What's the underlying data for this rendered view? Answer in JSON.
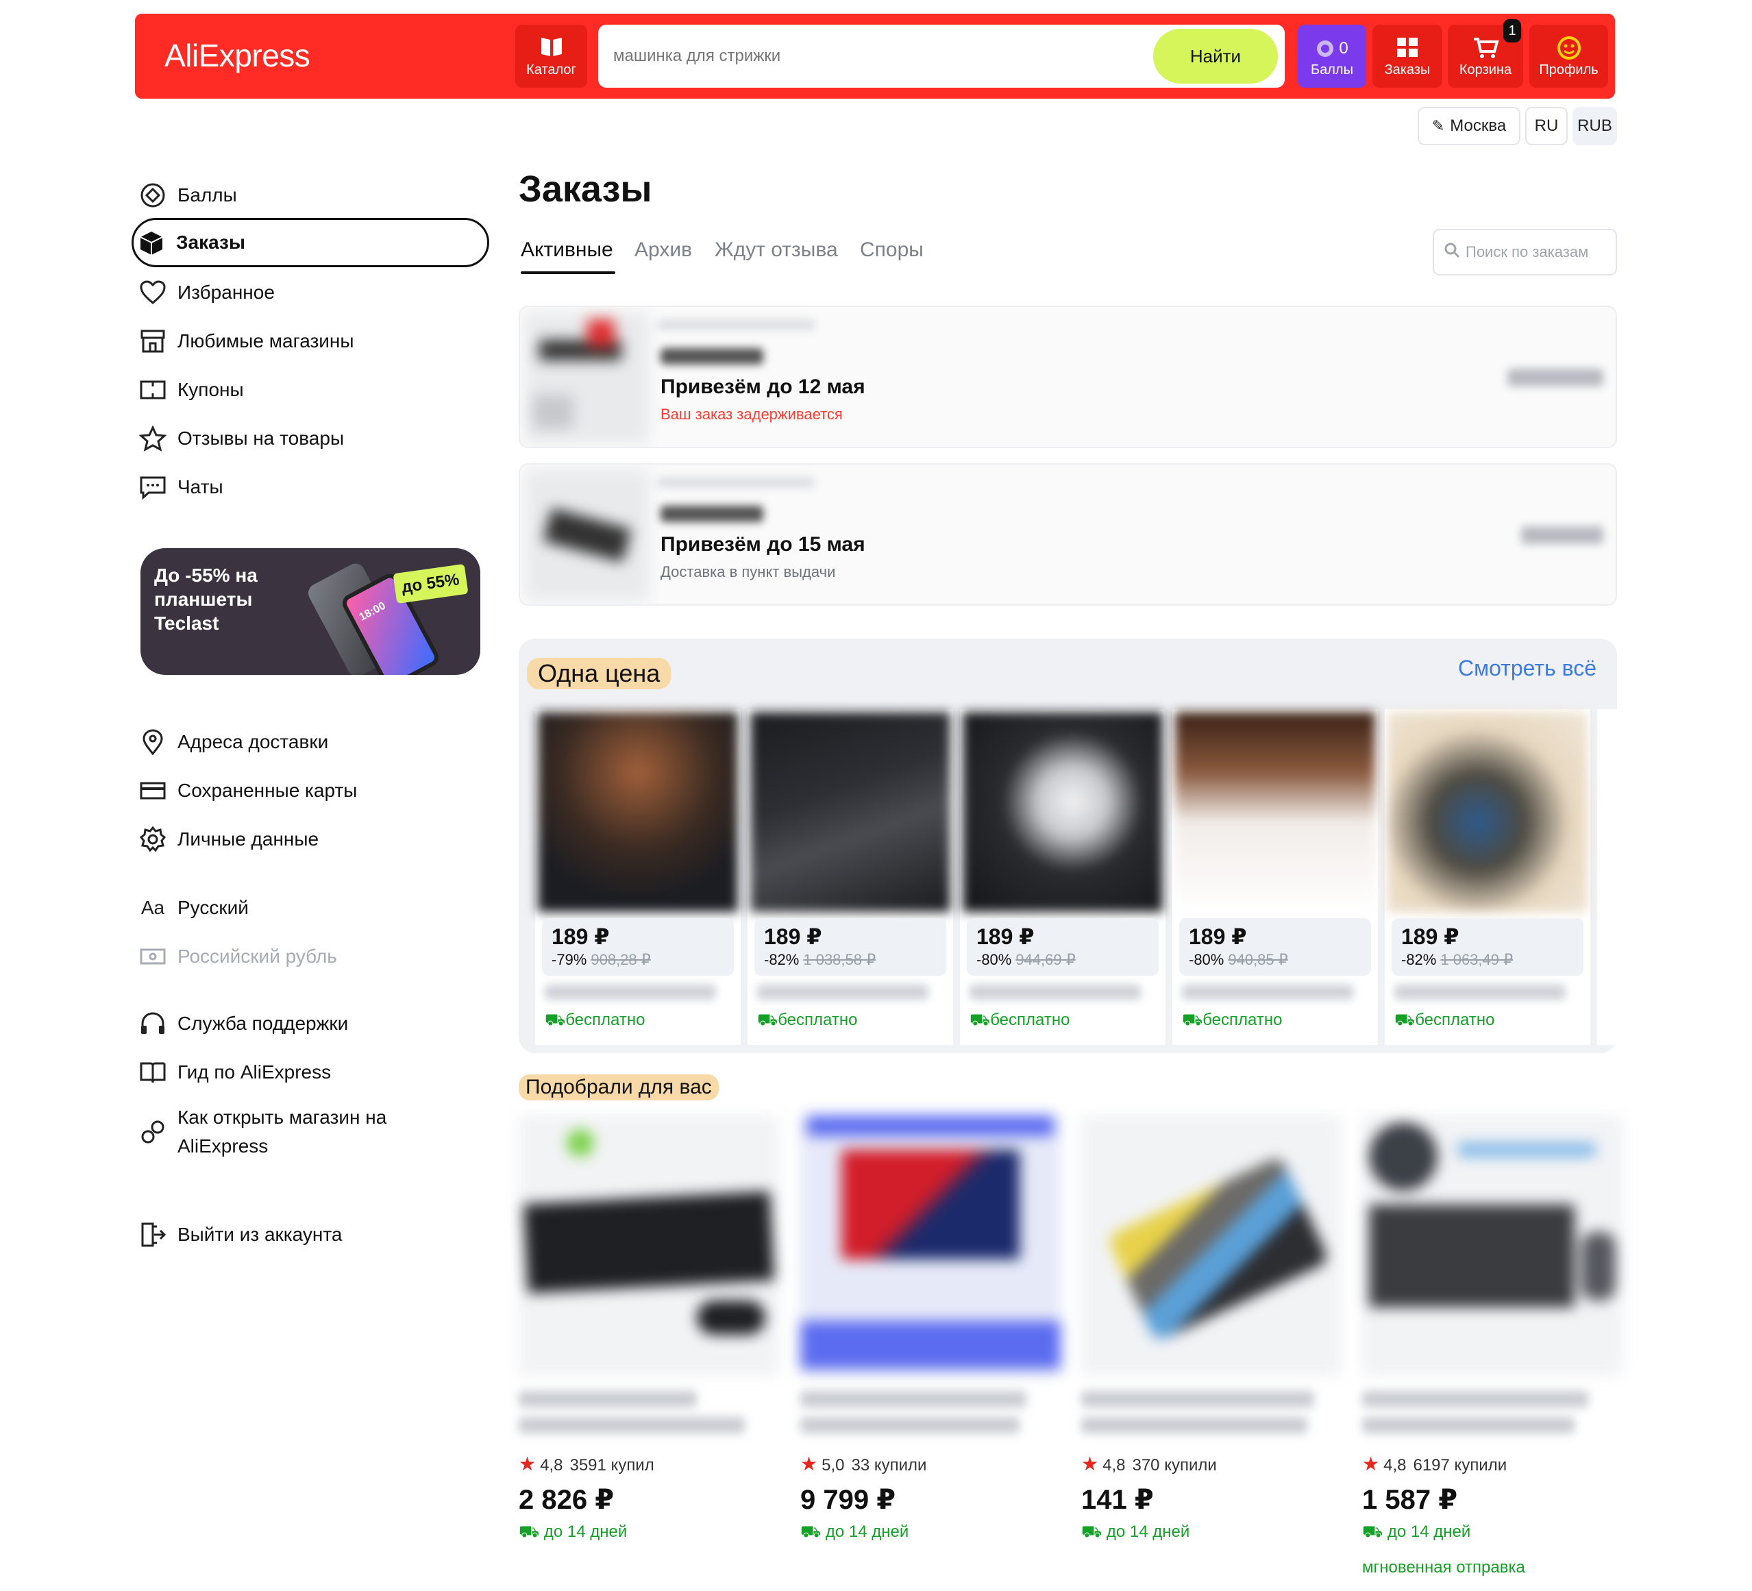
{
  "header": {
    "logo": "AliExpress",
    "catalog_label": "Каталог",
    "search_placeholder": "машинка для стрижки",
    "search_button": "Найти",
    "points_value": "0",
    "points_label": "Баллы",
    "orders_label": "Заказы",
    "cart_label": "Корзина",
    "cart_count": "1",
    "profile_label": "Профиль",
    "city": "Москва",
    "language": "RU",
    "currency": "RUB",
    "brand_color": "#ff2b24"
  },
  "sidebar": {
    "items": [
      {
        "label": "Баллы",
        "icon": "points-icon"
      },
      {
        "label": "Заказы",
        "icon": "box-icon"
      },
      {
        "label": "Избранное",
        "icon": "heart-icon"
      },
      {
        "label": "Любимые магазины",
        "icon": "store-icon"
      },
      {
        "label": "Купоны",
        "icon": "coupon-icon"
      },
      {
        "label": "Отзывы на товары",
        "icon": "star-icon"
      },
      {
        "label": "Чаты",
        "icon": "chat-icon"
      }
    ],
    "promo": {
      "text": "До -55% на планшеты Teclast",
      "badge": "до 55%",
      "screen_time": "18:00"
    },
    "items2": [
      {
        "label": "Адреса доставки",
        "icon": "location-icon"
      },
      {
        "label": "Сохраненные карты",
        "icon": "card-icon"
      },
      {
        "label": "Личные данные",
        "icon": "gear-icon"
      }
    ],
    "language_icon": "Aa",
    "language": "Русский",
    "currency": "Российский рубль",
    "items3": [
      {
        "label": "Служба поддержки",
        "icon": "headphones-icon"
      },
      {
        "label": "Гид по AliExpress",
        "icon": "book-icon"
      },
      {
        "label": "Как открыть магазин на AliExpress",
        "icon": "shop-open-icon"
      }
    ],
    "logout": "Выйти из аккаунта"
  },
  "main": {
    "title": "Заказы",
    "tabs": [
      "Активные",
      "Архив",
      "Ждут отзыва",
      "Споры"
    ],
    "order_search_placeholder": "Поиск по заказам",
    "orders": [
      {
        "date": "Привезём до 12 мая",
        "status": "Ваш заказ задерживается"
      },
      {
        "date": "Привезём до 15 мая",
        "status": "Доставка в пункт выдачи"
      }
    ],
    "one_price": {
      "title": "Одна цена",
      "see_all": "Смотреть всё",
      "items": [
        {
          "price": "189 ₽",
          "discount": "-79%",
          "old_price": "908,28 ₽",
          "delivery": "бесплатно"
        },
        {
          "price": "189 ₽",
          "discount": "-82%",
          "old_price": "1 038,58 ₽",
          "delivery": "бесплатно"
        },
        {
          "price": "189 ₽",
          "discount": "-80%",
          "old_price": "944,69 ₽",
          "delivery": "бесплатно"
        },
        {
          "price": "189 ₽",
          "discount": "-80%",
          "old_price": "940,85 ₽",
          "delivery": "бесплатно"
        },
        {
          "price": "189 ₽",
          "discount": "-82%",
          "old_price": "1 063,49 ₽",
          "delivery": "бесплатно"
        }
      ]
    },
    "recommended": {
      "title": "Подобрали для вас",
      "items": [
        {
          "rating": "4,8",
          "bought": "3591 купил",
          "price": "2 826 ₽",
          "delivery": "до 14 дней",
          "extra": ""
        },
        {
          "rating": "5,0",
          "bought": "33 купили",
          "price": "9 799 ₽",
          "delivery": "до 14 дней",
          "extra": ""
        },
        {
          "rating": "4,8",
          "bought": "370 купили",
          "price": "141 ₽",
          "delivery": "до 14 дней",
          "extra": ""
        },
        {
          "rating": "4,8",
          "bought": "6197 купили",
          "price": "1 587 ₽",
          "delivery": "до 14 дней",
          "extra": "мгновенная отправка"
        }
      ]
    }
  }
}
